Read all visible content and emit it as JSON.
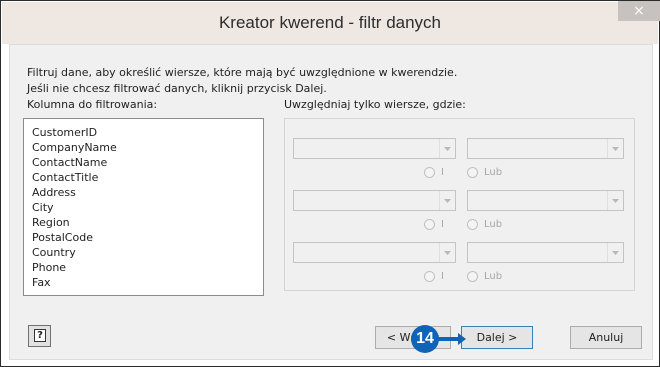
{
  "window": {
    "title": "Kreator kwerend - filtr danych",
    "close_glyph": "×"
  },
  "instructions": {
    "line1": "Filtruj dane, aby określić wiersze, które mają być uwzględnione w kwerendzie.",
    "line2": "Jeśli nie chcesz filtrować danych, kliknij przycisk Dalej."
  },
  "columns": {
    "label": "Kolumna do filtrowania:",
    "items": [
      "CustomerID",
      "CompanyName",
      "ContactName",
      "ContactTitle",
      "Address",
      "City",
      "Region",
      "PostalCode",
      "Country",
      "Phone",
      "Fax"
    ]
  },
  "filter": {
    "label": "Uwzględniaj tylko wiersze, gdzie:",
    "and_label": "I",
    "or_label": "Lub"
  },
  "buttons": {
    "help_glyph": "?",
    "back_label": "< Wstecz",
    "next_label": "Dalej >",
    "cancel_label": "Anuluj"
  },
  "annotation": {
    "step_number": "14"
  },
  "colors": {
    "titlebar": "#efe8e2",
    "client": "#f0f0f0",
    "callout": "#0f64b7"
  }
}
